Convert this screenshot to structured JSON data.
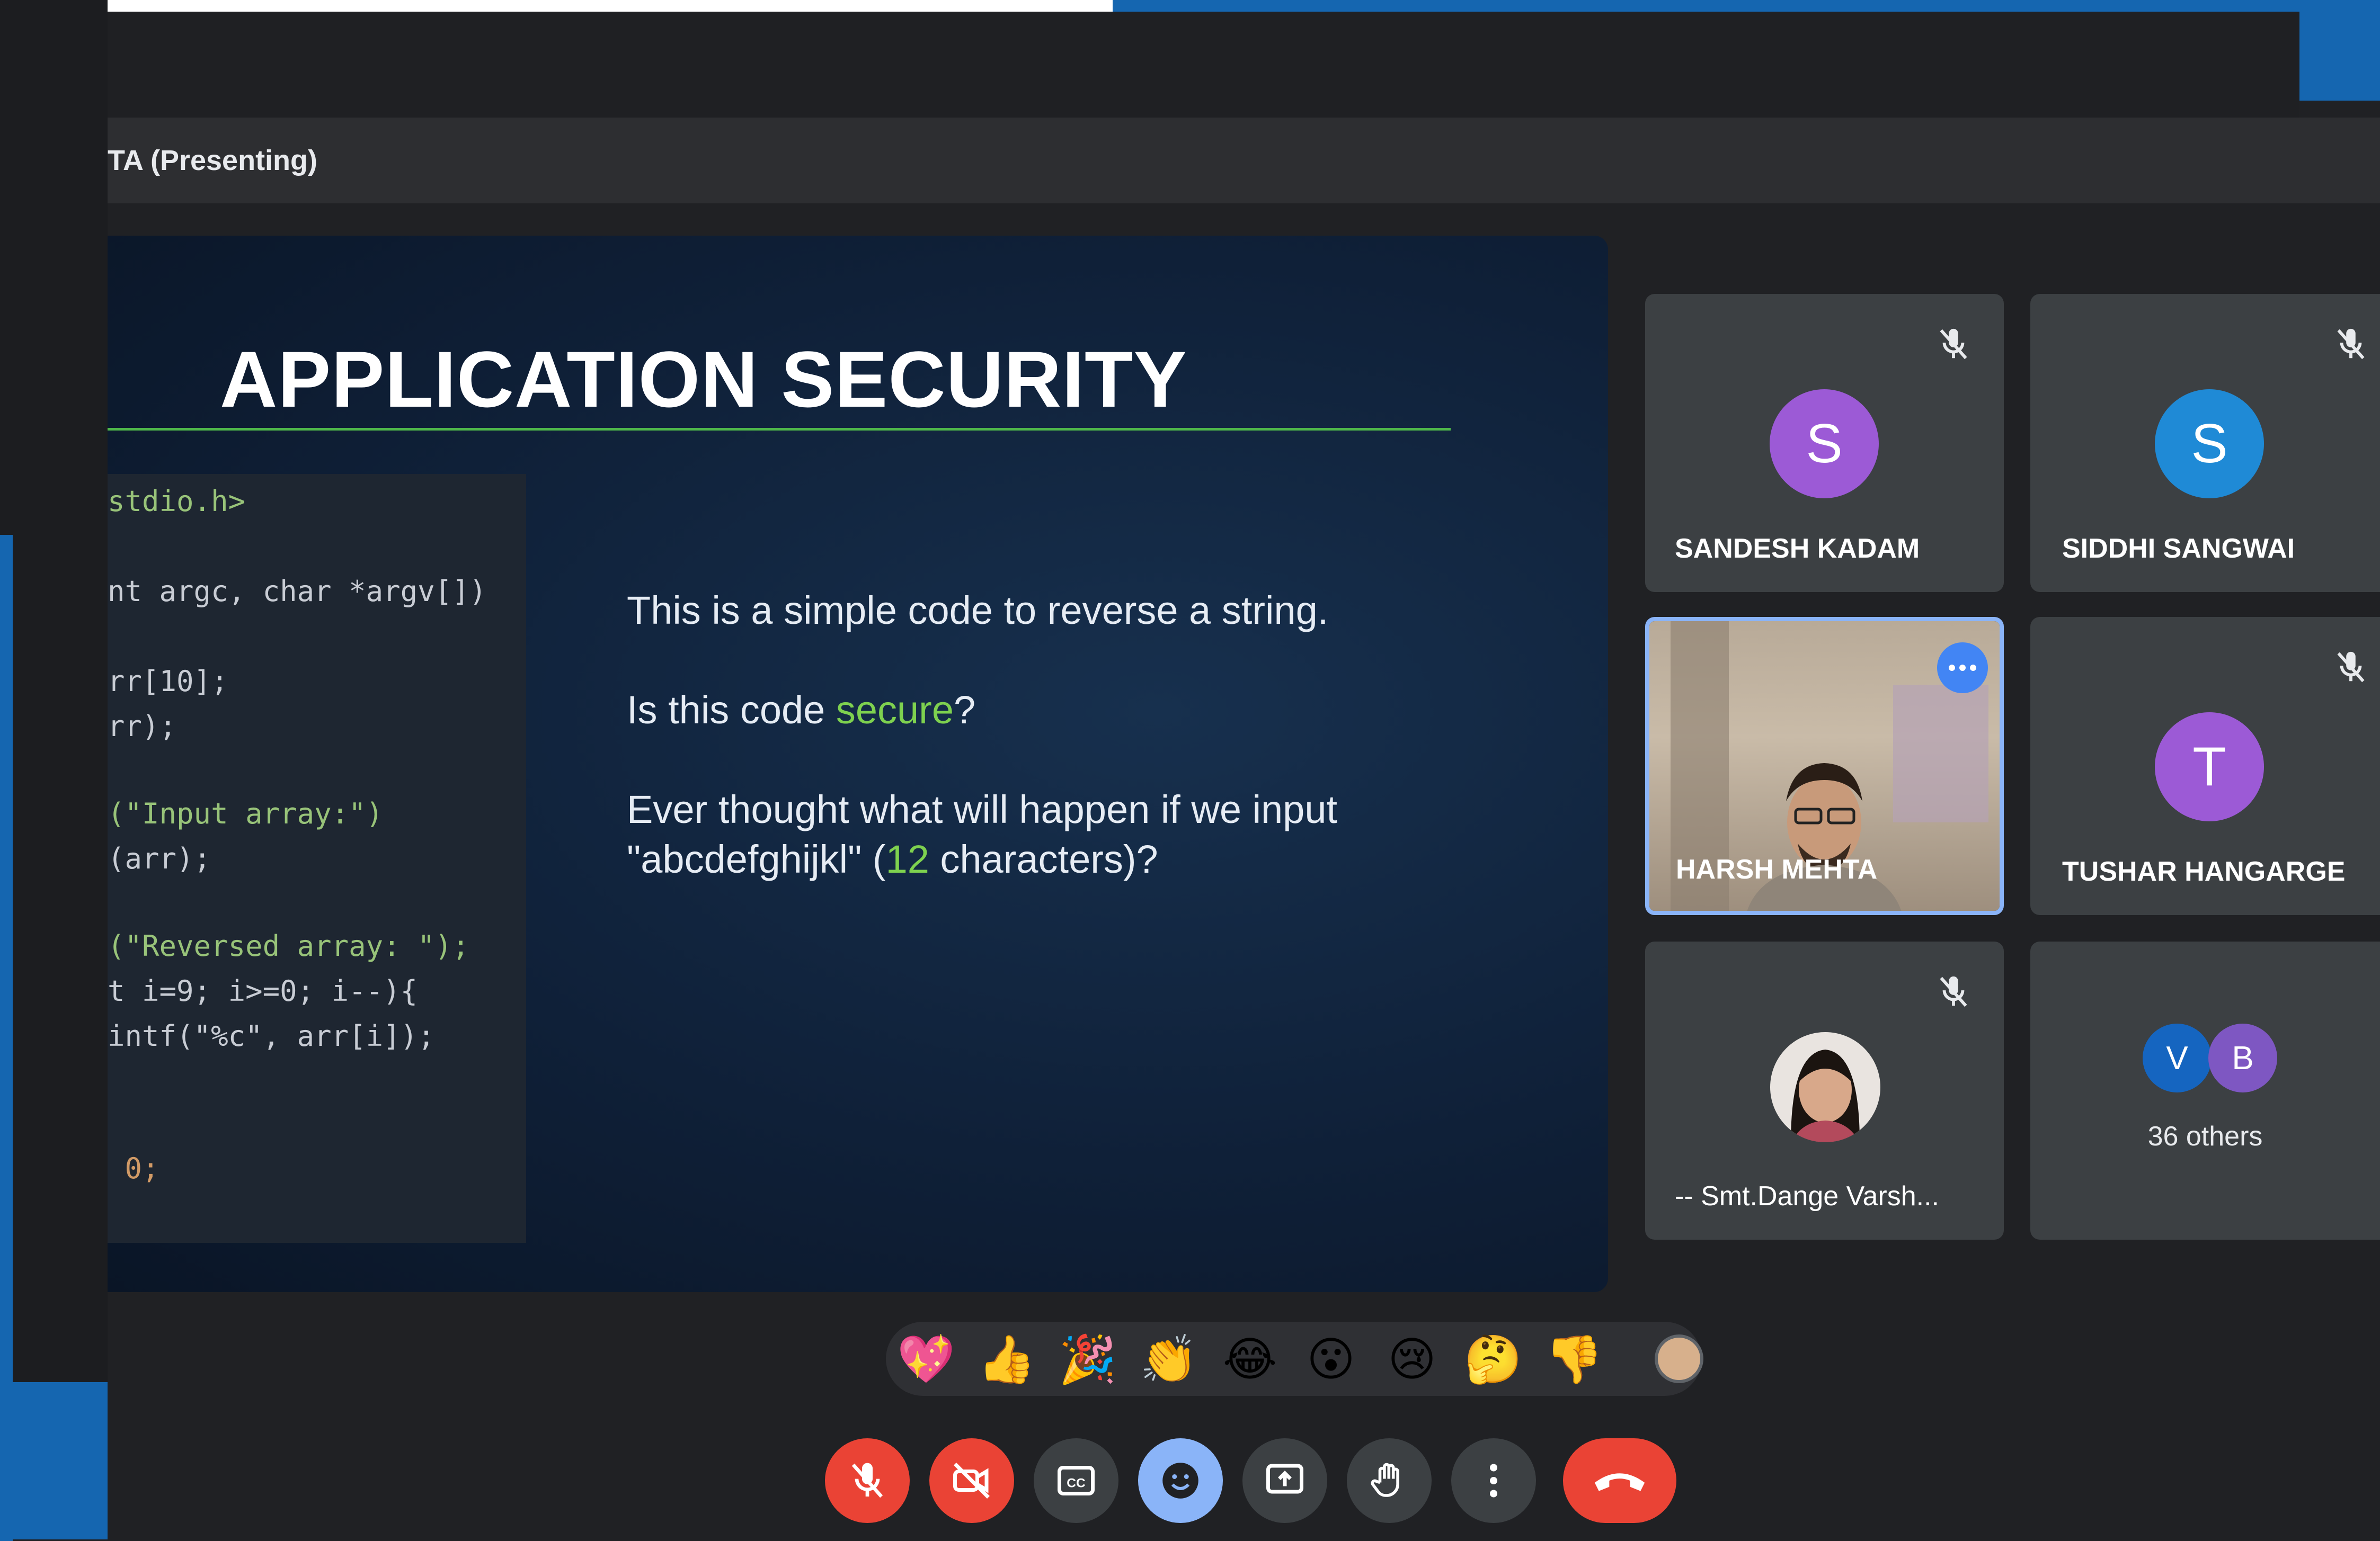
{
  "window": {
    "title": "TA (Presenting)"
  },
  "slide": {
    "title": "APPLICATION SECURITY",
    "code_lines": [
      "stdio.h>",
      "nt argc, char *argv[])",
      "rr[10];",
      "rr);",
      "(\"Input array:\")",
      "(arr);",
      "(\"Reversed array: \");",
      "t i=9; i>=0; i--){",
      "intf(\"%c\", arr[i]);",
      " 0;"
    ],
    "line1": "This is a simple code to reverse a string.",
    "line2_prefix": "Is this code ",
    "line2_highlight": "secure",
    "line2_suffix": "?",
    "line3a": "Ever thought what will happen if we input",
    "line3b_prefix": "\"abcdefghijkl\" (",
    "line3b_highlight": "12",
    "line3b_suffix": " characters)?"
  },
  "participants": [
    {
      "name": "SANDESH KADAM",
      "initial": "S",
      "color": "#9c5ad6",
      "muted": true
    },
    {
      "name": "SIDDHI SANGWAI",
      "initial": "S",
      "color": "#1f8ad6",
      "muted": true
    },
    {
      "name": "HARSH MEHTA",
      "video": true,
      "speaking": true
    },
    {
      "name": "TUSHAR HANGARGE",
      "initial": "T",
      "color": "#9c5ad6",
      "muted": true
    },
    {
      "name": "-- Smt.Dange Varsh...",
      "photo": true,
      "muted": true
    },
    {
      "others_count_label": "36 others",
      "initials": [
        "V",
        "B"
      ],
      "colors": [
        "#1565c0",
        "#7e57c2"
      ]
    }
  ],
  "reactions": [
    "💖",
    "👍",
    "🎉",
    "👏",
    "😂",
    "😮",
    "😢",
    "🤔",
    "👎"
  ],
  "controls": [
    {
      "name": "mic-off",
      "color": "#ea4335"
    },
    {
      "name": "camera-off",
      "color": "#ea4335"
    },
    {
      "name": "captions",
      "color": "#3c4043"
    },
    {
      "name": "emoji",
      "color": "#8ab4f8"
    },
    {
      "name": "present-now",
      "color": "#3c4043"
    },
    {
      "name": "raise-hand",
      "color": "#3c4043"
    },
    {
      "name": "more-options",
      "color": "#3c4043"
    },
    {
      "name": "leave-call",
      "color": "#ea4335"
    }
  ]
}
